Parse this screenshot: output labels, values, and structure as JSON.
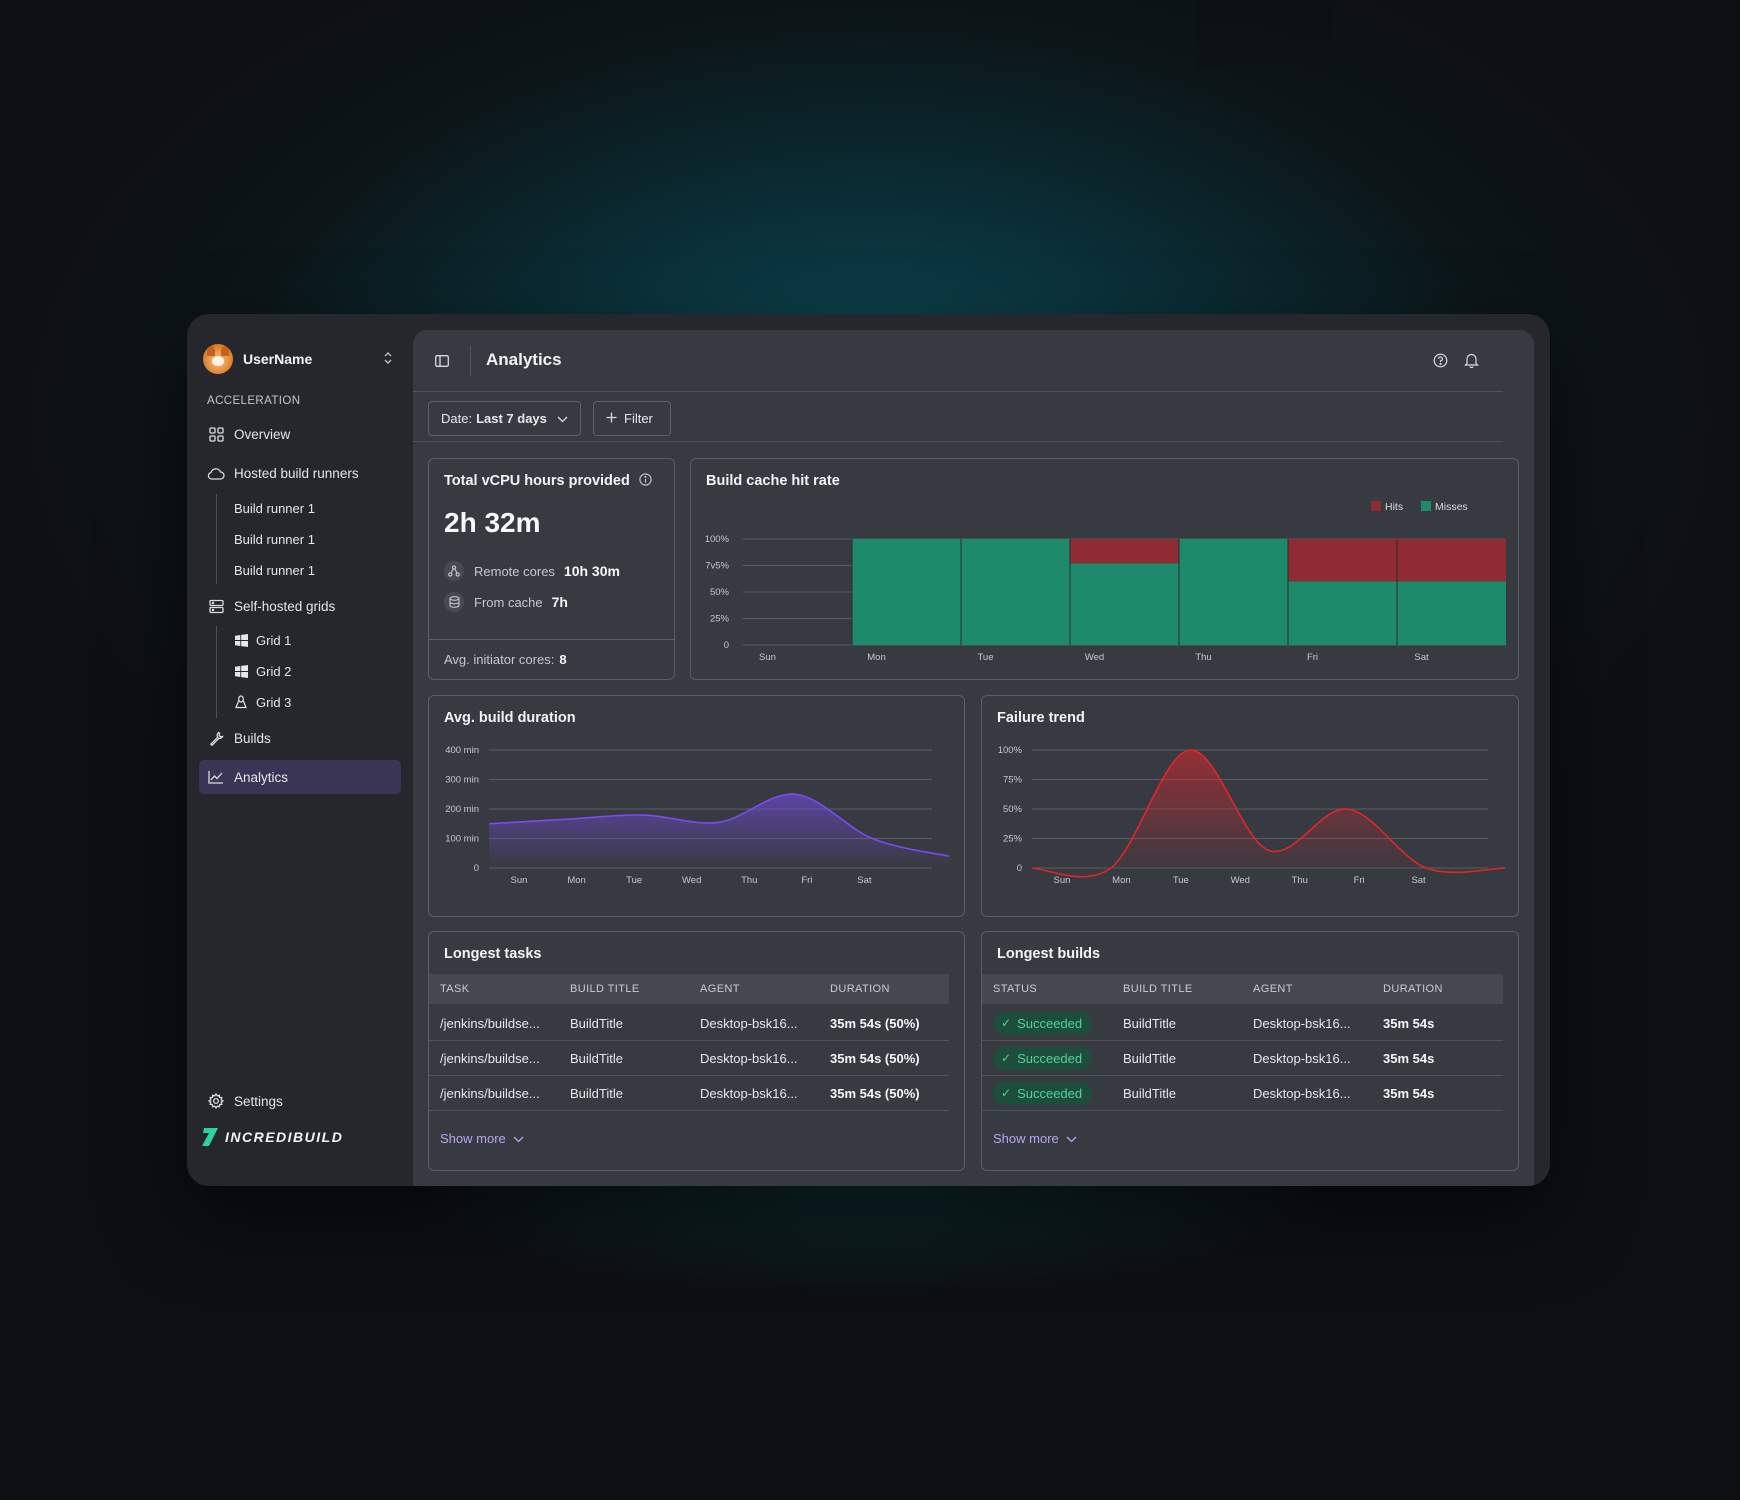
{
  "sidebar": {
    "username": "UserName",
    "section_label": "ACCELERATION",
    "overview": "Overview",
    "hosted_build_runners": "Hosted build runners",
    "runners": [
      "Build runner 1",
      "Build runner 1",
      "Build runner 1"
    ],
    "self_hosted_grids": "Self-hosted grids",
    "grids": [
      "Grid 1",
      "Grid 2",
      "Grid 3"
    ],
    "builds": "Builds",
    "analytics": "Analytics",
    "settings": "Settings",
    "brand": "INCREDIBUILD"
  },
  "header": {
    "title": "Analytics"
  },
  "toolbar": {
    "date_prefix": "Date:",
    "date_value": "Last 7 days",
    "filter_label": "Filter"
  },
  "vcpu_card": {
    "title": "Total vCPU hours provided",
    "value": "2h 32m",
    "remote_label": "Remote cores",
    "remote_value": "10h 30m",
    "cache_label": "From cache",
    "cache_value": "7h",
    "footer_label": "Avg. initiator cores:",
    "footer_value": "8"
  },
  "colors": {
    "hits": "#8e2b33",
    "misses": "#1d8a6b",
    "duration_line": "#7a4cf0",
    "failure_line": "#e0262b",
    "accent": "#3b3555"
  },
  "chart_data": [
    {
      "type": "bar",
      "title": "Build cache hit rate",
      "categories": [
        "Sun",
        "Mon",
        "Tue",
        "Wed",
        "Thu",
        "Fri",
        "Sat"
      ],
      "y_ticks": [
        "0",
        "25%",
        "50%",
        "7v5%",
        "100%"
      ],
      "ylim": [
        0,
        100
      ],
      "stacked": true,
      "legend": "top-right",
      "series": [
        {
          "name": "Misses",
          "values": [
            0,
            100,
            100,
            77,
            100,
            60,
            60
          ]
        },
        {
          "name": "Hits",
          "values": [
            0,
            0,
            0,
            23,
            0,
            40,
            40
          ]
        }
      ]
    },
    {
      "type": "area",
      "title": "Avg. build duration",
      "categories": [
        "Sun",
        "Mon",
        "Tue",
        "Wed",
        "Thu",
        "Fri",
        "Sat"
      ],
      "y_ticks": [
        "0",
        "100 min",
        "200 min",
        "300 min",
        "400 min"
      ],
      "ylim": [
        0,
        400
      ],
      "grid": true,
      "series": [
        {
          "values": [
            150,
            165,
            180,
            155,
            250,
            100,
            40
          ]
        }
      ]
    },
    {
      "type": "area",
      "title": "Failure trend",
      "categories": [
        "Sun",
        "Mon",
        "Tue",
        "Wed",
        "Thu",
        "Fri",
        "Sat"
      ],
      "y_ticks": [
        "0",
        "25%",
        "50%",
        "75%",
        "100%"
      ],
      "ylim": [
        0,
        100
      ],
      "grid": true,
      "series": [
        {
          "values": [
            0,
            0,
            100,
            15,
            50,
            0,
            0
          ]
        }
      ]
    }
  ],
  "longest_tasks": {
    "title": "Longest tasks",
    "columns": [
      "TASK",
      "BUILD TITLE",
      "AGENT",
      "DURATION"
    ],
    "rows": [
      [
        "/jenkins/buildse...",
        "BuildTitle",
        "Desktop-bsk16...",
        "35m 54s (50%)"
      ],
      [
        "/jenkins/buildse...",
        "BuildTitle",
        "Desktop-bsk16...",
        "35m 54s (50%)"
      ],
      [
        "/jenkins/buildse...",
        "BuildTitle",
        "Desktop-bsk16...",
        "35m 54s (50%)"
      ]
    ],
    "show_more": "Show more"
  },
  "longest_builds": {
    "title": "Longest builds",
    "columns": [
      "STATUS",
      "BUILD TITLE",
      "AGENT",
      "DURATION"
    ],
    "rows": [
      [
        "Succeeded",
        "BuildTitle",
        "Desktop-bsk16...",
        "35m 54s"
      ],
      [
        "Succeeded",
        "BuildTitle",
        "Desktop-bsk16...",
        "35m 54s"
      ],
      [
        "Succeeded",
        "BuildTitle",
        "Desktop-bsk16...",
        "35m 54s"
      ]
    ],
    "show_more": "Show more"
  }
}
